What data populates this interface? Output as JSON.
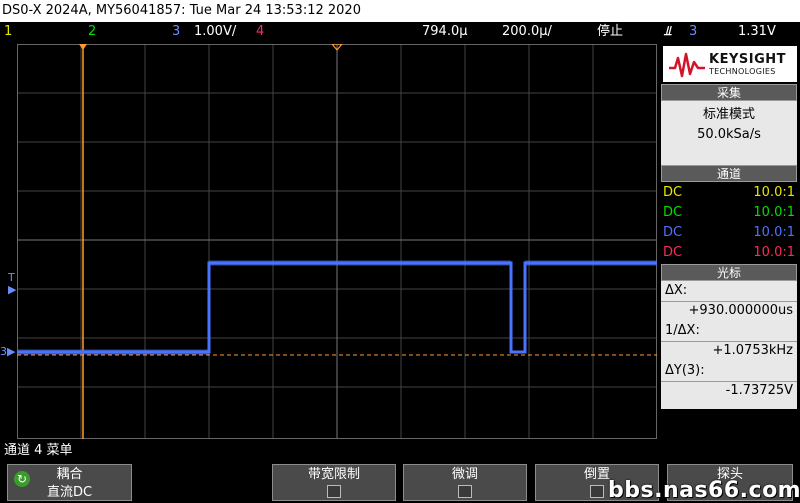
{
  "title_bar": "DS0-X 2024A, MY56041857: Tue Mar 24 13:53:12 2020",
  "status": {
    "ch1": "1",
    "ch2": "2",
    "ch3": "3",
    "ch3_scale": "1.00V/",
    "ch4": "4",
    "time_pos": "794.0µ",
    "time_scale": "200.0µ/",
    "run_state": "停止",
    "trig_icon": "ť",
    "trig_src": "3",
    "trig_level": "1.31V"
  },
  "markers": {
    "trigger": "T",
    "ch3_ground": "3"
  },
  "logo": {
    "name": "KEYSIGHT",
    "sub": "TECHNOLOGIES"
  },
  "acquire": {
    "header": "采集",
    "mode": "标准模式",
    "rate": "50.0kSa/s"
  },
  "channels": {
    "header": "通道",
    "rows": [
      {
        "coupling": "DC",
        "probe": "10.0:1",
        "color": "#e8e800"
      },
      {
        "coupling": "DC",
        "probe": "10.0:1",
        "color": "#00e000"
      },
      {
        "coupling": "DC",
        "probe": "10.0:1",
        "color": "#4a74ff"
      },
      {
        "coupling": "DC",
        "probe": "10.0:1",
        "color": "#ff2a5a"
      }
    ]
  },
  "cursors": {
    "header": "光标",
    "dx_label": "ΔX:",
    "dx_value": "+930.000000us",
    "inv_dx_label": "1/ΔX:",
    "inv_dx_value": "+1.0753kHz",
    "dy_label": "ΔY(3):",
    "dy_value": "-1.73725V"
  },
  "menu_title": "通道 4 菜单",
  "softkeys": [
    {
      "label": "耦合",
      "value": "直流DC"
    },
    {
      "label": "带宽限制"
    },
    {
      "label": "微调"
    },
    {
      "label": "倒置"
    },
    {
      "label": "探头"
    }
  ],
  "watermark": "bbs.nas66.com",
  "colors": {
    "ch1": "#e8e800",
    "ch2": "#00e000",
    "ch3": "#4a74ff",
    "ch4": "#ff2a5a",
    "cursor": "#ff9a30",
    "grid": "#555555"
  }
}
